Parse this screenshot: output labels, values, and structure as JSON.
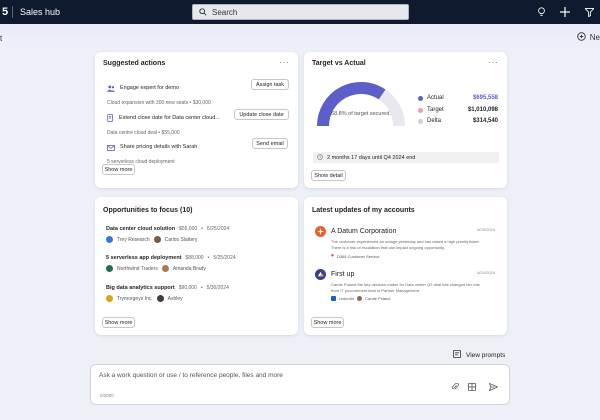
{
  "app": {
    "brand_glyph": "5",
    "name": "Sales hub"
  },
  "search": {
    "placeholder": "Search"
  },
  "header": {
    "left_stub": "t",
    "new_chat_label": "Ne"
  },
  "suggested_actions": {
    "title": "Suggested actions",
    "items": [
      {
        "icon": "people-icon",
        "title": "Engage expert for demo",
        "subtitle": "Cloud expansion with 300 new seats  •  $30,000",
        "action": "Assign task"
      },
      {
        "icon": "document-edit-icon",
        "title": "Extend close date for Data center cloud...",
        "subtitle": "Data centre cloud deal  •  $55,000",
        "action": "Update close date"
      },
      {
        "icon": "mail-icon",
        "title": "Share pricing details with Sarah",
        "subtitle": "5 serverless cloud deployment",
        "action": "Send email"
      }
    ],
    "show_more": "Show more"
  },
  "target": {
    "title": "Target vs Actual",
    "percent_text": "68.8% of target secured.",
    "percent_value": 68.8,
    "legend": [
      {
        "label": "Actual",
        "value": "$695,558",
        "color": "#5b5fc7",
        "value_color": "#5b5fc7"
      },
      {
        "label": "Target",
        "value": "$1,010,098",
        "color": "#e8a0ab",
        "value_color": "#242424"
      },
      {
        "label": "Delta",
        "value": "$314,540",
        "color": "#d1d1d1",
        "value_color": "#242424"
      }
    ],
    "remaining": "2 months 17 days until Q4 2024 end",
    "show_detail": "Show detail",
    "colors": {
      "actual": "#5b5fc7",
      "remaining": "#e8e8ee"
    }
  },
  "opportunities": {
    "title": "Opportunities to focus (10)",
    "items": [
      {
        "title": "Data center cloud solution",
        "value": "$55,000",
        "date": "6/25/2024",
        "company": "Trey Research",
        "person": "Carlos Slattery",
        "company_color": "#2f7bd9",
        "person_color": "#7a5a45"
      },
      {
        "title": "5 serverless app deployment",
        "value": "$88,000",
        "date": "5/25/2024",
        "company": "Northwind Traders",
        "person": "Amanda Brady",
        "company_color": "#1f6e5a",
        "person_color": "#b07850"
      },
      {
        "title": "Big data analytics support",
        "value": "$90,000",
        "date": "5/30/2024",
        "company": "Trymorgeys Inc.",
        "person": "Ashley",
        "company_color": "#e0a21a",
        "person_color": "#4a3a34"
      }
    ],
    "show_more": "Show more"
  },
  "updates": {
    "title": "Latest updates of my accounts",
    "items": [
      {
        "title": "A Datum Corporation",
        "date": "6/25/2024",
        "body": "The customer experienced an outage yesterday and has raised a high priority ticket. There is a risk of escalation that can impact ongoing opportunity.",
        "tag": "D365 Customer Service",
        "logo_color": "#e8612c"
      },
      {
        "title": "First up",
        "date": "6/24/2024",
        "body": "Carole Poland the key decision maker for Data center Q2 deal has changed her role from IT procurement lead to Partner Management.",
        "tag1": "LinkedIn",
        "tag2": "Carole Poland",
        "logo_color": "#3a3f8f"
      }
    ],
    "show_more": "Show more"
  },
  "prompt": {
    "view_prompts": "View prompts",
    "placeholder": "Ask a work question or use / to reference people, files and more",
    "counter": "0/2000"
  }
}
